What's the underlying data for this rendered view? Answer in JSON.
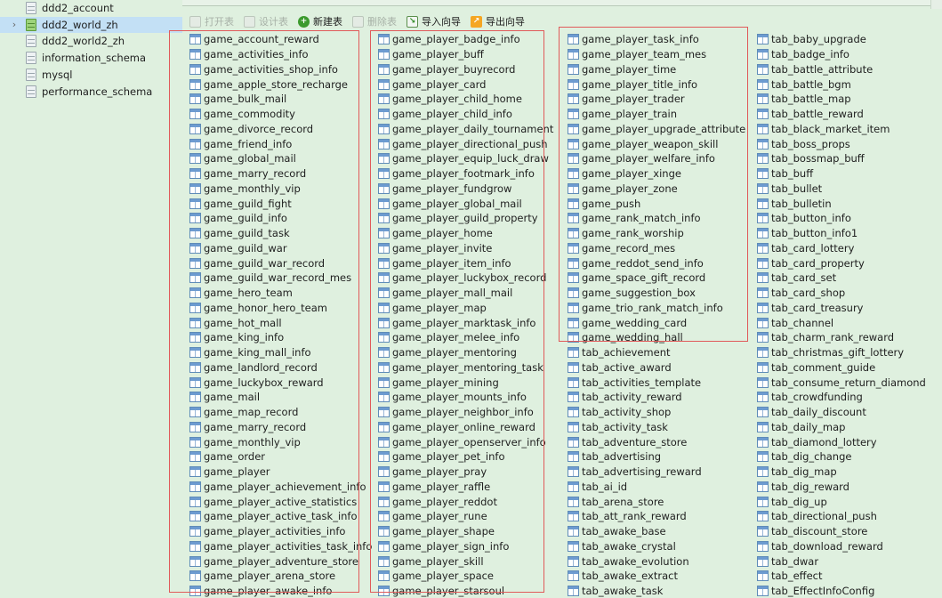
{
  "sidebar": {
    "databases": [
      {
        "label": "ddd2_account",
        "selected": false,
        "expander": ""
      },
      {
        "label": "ddd2_world_zh",
        "selected": true,
        "expander": "›"
      },
      {
        "label": "ddd2_world2_zh",
        "selected": false,
        "expander": ""
      },
      {
        "label": "information_schema",
        "selected": false,
        "expander": ""
      },
      {
        "label": "mysql",
        "selected": false,
        "expander": ""
      },
      {
        "label": "performance_schema",
        "selected": false,
        "expander": ""
      }
    ]
  },
  "toolbar": {
    "buttons": [
      {
        "label": "打开表",
        "icon": "open-table-icon",
        "disabled": true
      },
      {
        "label": "设计表",
        "icon": "design-table-icon",
        "disabled": true
      },
      {
        "label": "新建表",
        "icon": "new-table-icon",
        "disabled": false
      },
      {
        "label": "删除表",
        "icon": "delete-table-icon",
        "disabled": true
      },
      {
        "label": "导入向导",
        "icon": "import-wizard-icon",
        "disabled": false
      },
      {
        "label": "导出向导",
        "icon": "export-wizard-icon",
        "disabled": false
      }
    ]
  },
  "colors": {
    "background": "#dff0df",
    "selected": "#c3e0f5",
    "highlight_box": "#e05a5a"
  },
  "tables": {
    "columns": [
      [
        "game_account_reward",
        "game_activities_info",
        "game_activities_shop_info",
        "game_apple_store_recharge",
        "game_bulk_mail",
        "game_commodity",
        "game_divorce_record",
        "game_friend_info",
        "game_global_mail",
        "game_marry_record",
        "game_monthly_vip",
        "game_guild_fight",
        "game_guild_info",
        "game_guild_task",
        "game_guild_war",
        "game_guild_war_record",
        "game_guild_war_record_mes",
        "game_hero_team",
        "game_honor_hero_team",
        "game_hot_mall",
        "game_king_info",
        "game_king_mall_info",
        "game_landlord_record",
        "game_luckybox_reward",
        "game_mail",
        "game_map_record",
        "game_marry_record",
        "game_monthly_vip",
        "game_order",
        "game_player",
        "game_player_achievement_info",
        "game_player_active_statistics",
        "game_player_active_task_info",
        "game_player_activities_info",
        "game_player_activities_task_info",
        "game_player_adventure_store",
        "game_player_arena_store",
        "game_player_awake_info"
      ],
      [
        "game_player_badge_info",
        "game_player_buff",
        "game_player_buyrecord",
        "game_player_card",
        "game_player_child_home",
        "game_player_child_info",
        "game_player_daily_tournament",
        "game_player_directional_push",
        "game_player_equip_luck_draw",
        "game_player_footmark_info",
        "game_player_fundgrow",
        "game_player_global_mail",
        "game_player_guild_property",
        "game_player_home",
        "game_player_invite",
        "game_player_item_info",
        "game_player_luckybox_record",
        "game_player_mall_mail",
        "game_player_map",
        "game_player_marktask_info",
        "game_player_melee_info",
        "game_player_mentoring",
        "game_player_mentoring_task",
        "game_player_mining",
        "game_player_mounts_info",
        "game_player_neighbor_info",
        "game_player_online_reward",
        "game_player_openserver_info",
        "game_player_pet_info",
        "game_player_pray",
        "game_player_raffle",
        "game_player_reddot",
        "game_player_rune",
        "game_player_shape",
        "game_player_sign_info",
        "game_player_skill",
        "game_player_space",
        "game_player_starsoul"
      ],
      [
        "game_player_task_info",
        "game_player_team_mes",
        "game_player_time",
        "game_player_title_info",
        "game_player_trader",
        "game_player_train",
        "game_player_upgrade_attribute",
        "game_player_weapon_skill",
        "game_player_welfare_info",
        "game_player_xinge",
        "game_player_zone",
        "game_push",
        "game_rank_match_info",
        "game_rank_worship",
        "game_record_mes",
        "game_reddot_send_info",
        "game_space_gift_record",
        "game_suggestion_box",
        "game_trio_rank_match_info",
        "game_wedding_card",
        "game_wedding_hall",
        "tab_achievement",
        "tab_active_award",
        "tab_activities_template",
        "tab_activity_reward",
        "tab_activity_shop",
        "tab_activity_task",
        "tab_adventure_store",
        "tab_advertising",
        "tab_advertising_reward",
        "tab_ai_id",
        "tab_arena_store",
        "tab_att_rank_reward",
        "tab_awake_base",
        "tab_awake_crystal",
        "tab_awake_evolution",
        "tab_awake_extract",
        "tab_awake_task"
      ],
      [
        "tab_baby_upgrade",
        "tab_badge_info",
        "tab_battle_attribute",
        "tab_battle_bgm",
        "tab_battle_map",
        "tab_battle_reward",
        "tab_black_market_item",
        "tab_boss_props",
        "tab_bossmap_buff",
        "tab_buff",
        "tab_bullet",
        "tab_bulletin",
        "tab_button_info",
        "tab_button_info1",
        "tab_card_lottery",
        "tab_card_property",
        "tab_card_set",
        "tab_card_shop",
        "tab_card_treasury",
        "tab_channel",
        "tab_charm_rank_reward",
        "tab_christmas_gift_lottery",
        "tab_comment_guide",
        "tab_consume_return_diamond",
        "tab_crowdfunding",
        "tab_daily_discount",
        "tab_daily_map",
        "tab_diamond_lottery",
        "tab_dig_change",
        "tab_dig_map",
        "tab_dig_reward",
        "tab_dig_up",
        "tab_directional_push",
        "tab_discount_store",
        "tab_download_reward",
        "tab_dwar",
        "tab_effect",
        "tab_EffectInfoConfig"
      ]
    ]
  }
}
